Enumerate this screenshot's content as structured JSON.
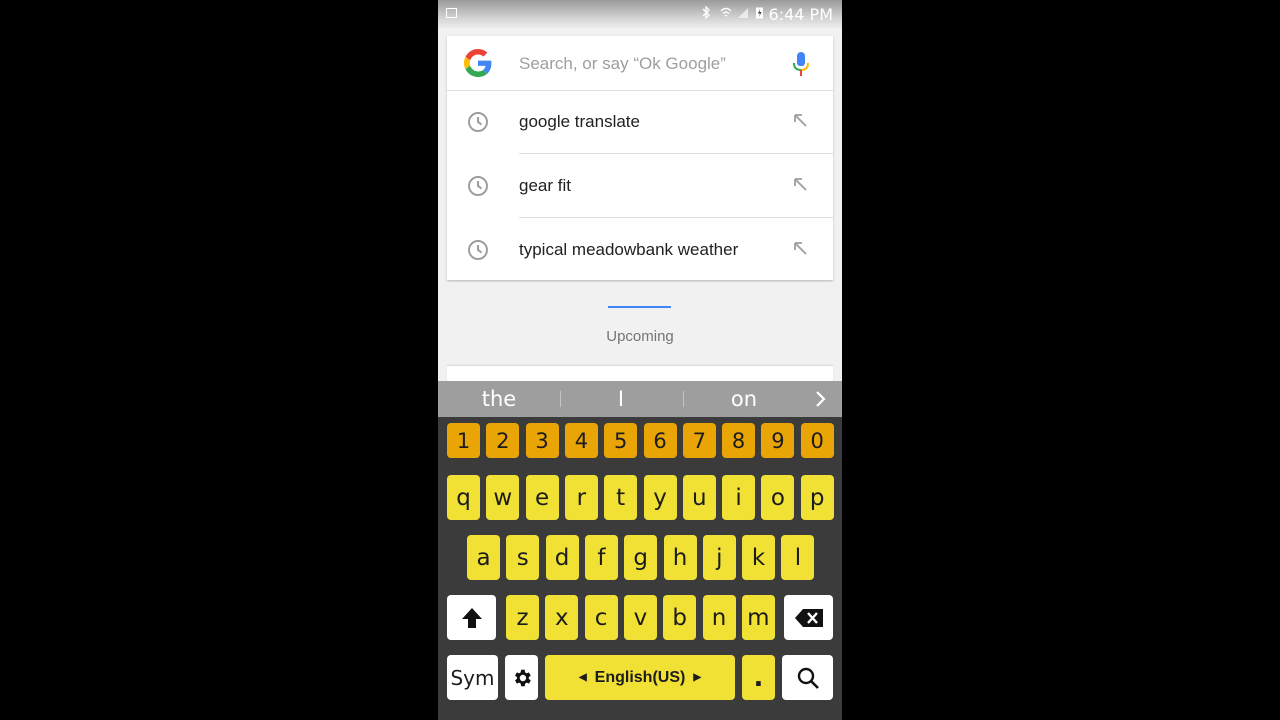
{
  "status_bar": {
    "time": "6:44 PM"
  },
  "search": {
    "placeholder": "Search, or say “Ok Google”",
    "suggestions": [
      {
        "text": "google translate"
      },
      {
        "text": "gear fit"
      },
      {
        "text": "typical meadowbank weather"
      }
    ]
  },
  "upcoming": {
    "label": "Upcoming"
  },
  "prediction_bar": {
    "words": [
      "the",
      "I",
      "on"
    ]
  },
  "keyboard": {
    "number_row": [
      "1",
      "2",
      "3",
      "4",
      "5",
      "6",
      "7",
      "8",
      "9",
      "0"
    ],
    "row1": [
      "q",
      "w",
      "e",
      "r",
      "t",
      "y",
      "u",
      "i",
      "o",
      "p"
    ],
    "row2": [
      "a",
      "s",
      "d",
      "f",
      "g",
      "h",
      "j",
      "k",
      "l"
    ],
    "row3": [
      "z",
      "x",
      "c",
      "v",
      "b",
      "n",
      "m"
    ],
    "sym_label": "Sym",
    "space_label": "English(US)",
    "period_label": ".",
    "colors": {
      "number_keys": "#e9a406",
      "letter_keys": "#f1e134",
      "background": "#3b3b3b"
    }
  },
  "icons": [
    "google-logo-icon",
    "mic-icon",
    "history-clock-icon",
    "insert-arrow-icon",
    "shift-icon",
    "backspace-icon",
    "gear-icon",
    "search-icon",
    "chevron-right-icon"
  ]
}
